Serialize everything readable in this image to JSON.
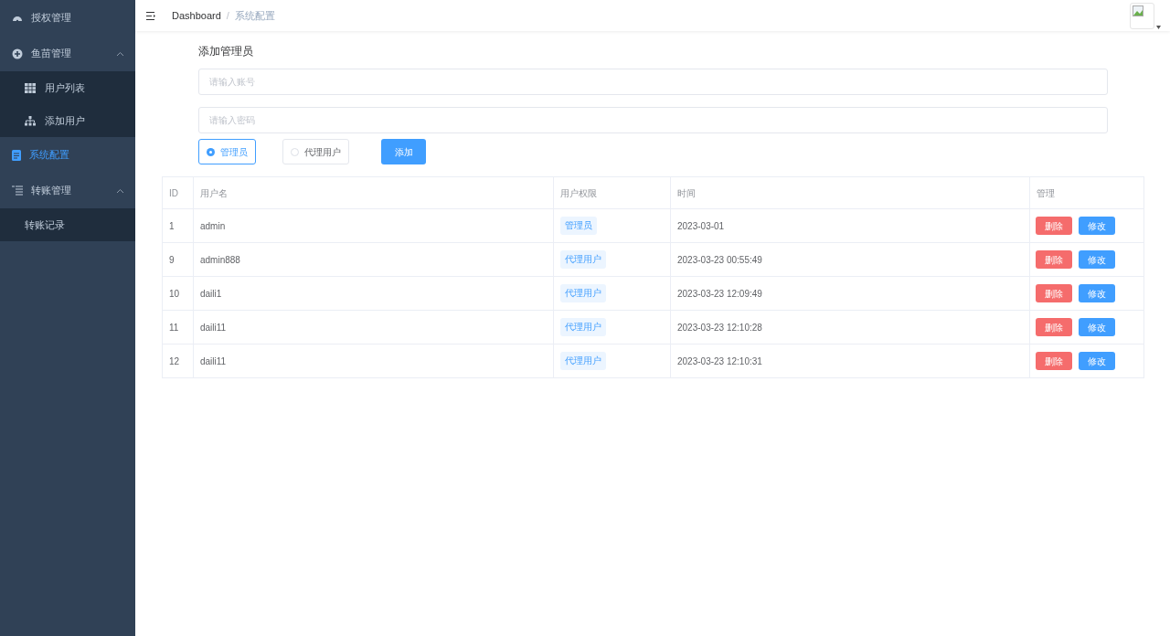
{
  "sidebar": {
    "items": [
      {
        "label": "授权管理",
        "selected": false
      },
      {
        "label": "鱼苗管理",
        "selected": false,
        "expanded": true,
        "children": [
          {
            "label": "用户列表",
            "selected": false
          },
          {
            "label": "添加用户",
            "selected": false
          }
        ]
      },
      {
        "label": "系统配置",
        "selected": true
      },
      {
        "label": "转账管理",
        "selected": false,
        "expanded": true,
        "children": [
          {
            "label": "转账记录",
            "selected": false
          }
        ]
      }
    ]
  },
  "breadcrumb": {
    "items": [
      {
        "label": "Dashboard"
      },
      {
        "label": "系统配置"
      }
    ],
    "separator": "/"
  },
  "form": {
    "title": "添加管理员",
    "account": {
      "placeholder": "请输入账号"
    },
    "password": {
      "placeholder": "请输入密码"
    },
    "roles": [
      {
        "label": "管理员",
        "selected": true
      },
      {
        "label": "代理用户",
        "selected": false
      }
    ],
    "submit": "添加"
  },
  "table": {
    "columns": [
      "ID",
      "用户名",
      "用户权限",
      "时间",
      "管理"
    ],
    "rows": [
      {
        "id": "1",
        "username": "admin",
        "role": "管理员",
        "time": "2023-03-01",
        "actions": [
          "删除",
          "修改"
        ]
      },
      {
        "id": "9",
        "username": "admin888",
        "role": "代理用户",
        "time": "2023-03-23 00:55:49",
        "actions": [
          "删除",
          "修改"
        ]
      },
      {
        "id": "10",
        "username": "daili1",
        "role": "代理用户",
        "time": "2023-03-23 12:09:49",
        "actions": [
          "删除",
          "修改"
        ]
      },
      {
        "id": "11",
        "username": "daili11",
        "role": "代理用户",
        "time": "2023-03-23 12:10:28",
        "actions": [
          "删除",
          "修改"
        ]
      },
      {
        "id": "12",
        "username": "daili11",
        "role": "代理用户",
        "time": "2023-03-23 12:10:31",
        "actions": [
          "删除",
          "修改"
        ]
      }
    ]
  }
}
